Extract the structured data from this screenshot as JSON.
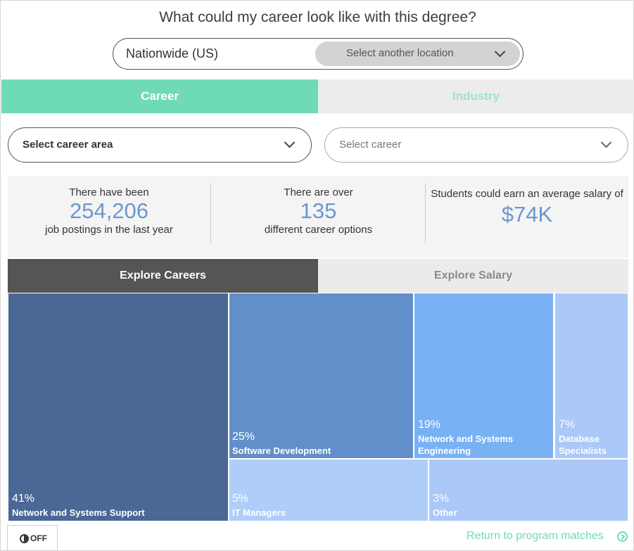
{
  "header": {
    "title": "What could my career look like with this degree?"
  },
  "location": {
    "current": "Nationwide (US)",
    "select_label": "Select another location"
  },
  "tabs": {
    "career": "Career",
    "industry": "Industry"
  },
  "filters": {
    "career_area": "Select career area",
    "career": "Select career"
  },
  "stats": {
    "postings": {
      "pre": "There have been",
      "value": "254,206",
      "post": "job postings in the last year"
    },
    "careers": {
      "pre": "There are over",
      "value": "135",
      "post": "different career options"
    },
    "salary": {
      "pre": "Students could earn an average salary of",
      "value": "$74K"
    }
  },
  "explore_tabs": {
    "careers": "Explore Careers",
    "salary": "Explore Salary"
  },
  "treemap": {
    "items": [
      {
        "pct": "41%",
        "label": "Network and Systems Support",
        "color": "#4a6895"
      },
      {
        "pct": "25%",
        "label": "Software Development",
        "color": "#628fc9"
      },
      {
        "pct": "19%",
        "label": "Network and Systems Engineering",
        "color": "#7ab1f4"
      },
      {
        "pct": "7%",
        "label": "Database Specialists",
        "color": "#aac8f8"
      },
      {
        "pct": "5%",
        "label": "IT Managers",
        "color": "#aecdf9"
      },
      {
        "pct": "3%",
        "label": "Other",
        "color": "#aac8f8"
      }
    ]
  },
  "footer": {
    "accessibility": "OFF",
    "return_link": "Return to program matches"
  }
}
